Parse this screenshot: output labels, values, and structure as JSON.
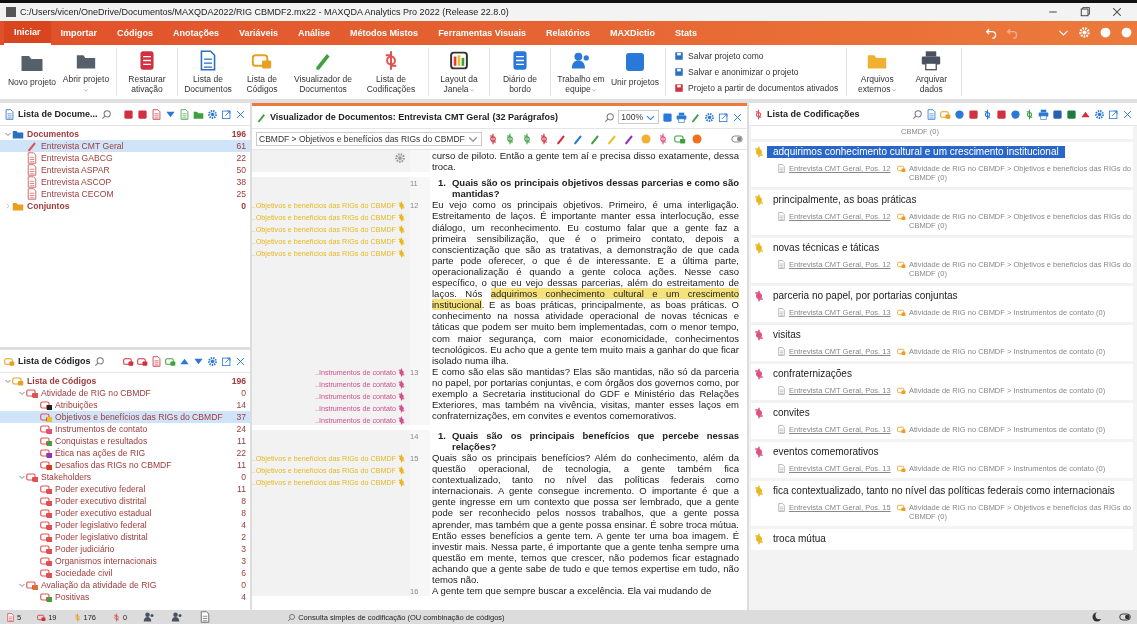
{
  "window": {
    "title": "C:/Users/vicen/OneDrive/Documentos/MAXQDA2022/RIG CBMDF2.mx22 - MAXQDA Analytics Pro 2022 (Release 22.8.0)"
  },
  "tabs": [
    {
      "label": "Iniciar",
      "selected": true
    },
    {
      "label": "Importar",
      "selected": false
    },
    {
      "label": "Códigos",
      "selected": false
    },
    {
      "label": "Anotações",
      "selected": false
    },
    {
      "label": "Variáveis",
      "selected": false
    },
    {
      "label": "Análise",
      "selected": false
    },
    {
      "label": "Métodos Mistos",
      "selected": false
    },
    {
      "label": "Ferramentas Visuais",
      "selected": false
    },
    {
      "label": "Relatórios",
      "selected": false
    },
    {
      "label": "MAXDictio",
      "selected": false
    },
    {
      "label": "Stats",
      "selected": false
    }
  ],
  "ribbon": {
    "groups": [
      [
        {
          "label": "Novo projeto",
          "dropdown": false
        },
        {
          "label": "Abrir projeto",
          "dropdown": true
        }
      ],
      [
        {
          "label": "Restaurar ativação",
          "dropdown": false
        }
      ],
      [
        {
          "label": "Lista de Documentos",
          "dropdown": false
        },
        {
          "label": "Lista de Códigos",
          "dropdown": false
        },
        {
          "label": "Visualizador de Documentos",
          "dropdown": false
        },
        {
          "label": "Lista de Codificações",
          "dropdown": false
        }
      ],
      [
        {
          "label": "Layout da Janela",
          "dropdown": true
        }
      ],
      [
        {
          "label": "Diário de bordo",
          "dropdown": false
        }
      ],
      [
        {
          "label": "Trabalho em equipe",
          "dropdown": true
        },
        {
          "label": "Unir projetos",
          "dropdown": false
        }
      ]
    ],
    "small_actions": [
      "Salvar projeto como",
      "Salvar e anonimizar o projeto",
      "Projeto a partir de documentos ativados"
    ],
    "end_buttons": [
      {
        "label": "Arquivos externos",
        "dropdown": true
      },
      {
        "label": "Arquivar dados",
        "dropdown": false
      }
    ]
  },
  "document_list": {
    "title": "Lista de Docume...",
    "items": [
      {
        "label": "Documentos",
        "count": "196",
        "kind": "folder",
        "selected": false,
        "expanded": true,
        "children": [
          {
            "label": "Entrevista CMT Geral",
            "count": "61",
            "kind": "open-doc",
            "selected": true
          },
          {
            "label": "Entrevista GABCG",
            "count": "22",
            "kind": "doc",
            "selected": false
          },
          {
            "label": "Entrevista ASPAR",
            "count": "50",
            "kind": "doc",
            "selected": false
          },
          {
            "label": "Entrevista ASCOP",
            "count": "38",
            "kind": "doc",
            "selected": false
          },
          {
            "label": "Entrevista CECOM",
            "count": "25",
            "kind": "doc",
            "selected": false
          }
        ]
      },
      {
        "label": "Conjuntos",
        "count": "0",
        "kind": "sets",
        "selected": false,
        "expanded": false
      }
    ]
  },
  "code_list": {
    "title": "Lista de Códigos",
    "items": [
      {
        "label": "Lista de Códigos",
        "count": "196",
        "kind": "root",
        "selected": false,
        "expanded": true,
        "children": [
          {
            "label": "Atividade de RIG no CBMDF",
            "count": "0",
            "color": "#e05050",
            "selected": false,
            "expanded": true,
            "children": [
              {
                "label": "Atribuições",
                "count": "14",
                "color": "#202020",
                "selected": false
              },
              {
                "label": "Objetivos e benefícios das RIGs do CBMDF",
                "count": "37",
                "color": "#e8c020",
                "selected": true
              },
              {
                "label": "Instrumentos de contato",
                "count": "24",
                "color": "#e05080",
                "selected": false
              },
              {
                "label": "Conquistas e resultados",
                "count": "11",
                "color": "#40a040",
                "selected": false
              },
              {
                "label": "Ética nas ações de RIG",
                "count": "22",
                "color": "#9030c0",
                "selected": false
              },
              {
                "label": "Desafios das RIGs no CBMDF",
                "count": "11",
                "color": "#d04020",
                "selected": false
              }
            ]
          },
          {
            "label": "Stakeholders",
            "count": "0",
            "color": "#e05050",
            "selected": false,
            "expanded": true,
            "children": [
              {
                "label": "Poder executivo federal",
                "count": "11",
                "color": "#e05050",
                "selected": false
              },
              {
                "label": "Poder executivo distrital",
                "count": "8",
                "color": "#e05050",
                "selected": false
              },
              {
                "label": "Poder executivo estadual",
                "count": "8",
                "color": "#e05050",
                "selected": false
              },
              {
                "label": "Poder legislativo federal",
                "count": "4",
                "color": "#e05050",
                "selected": false
              },
              {
                "label": "Poder legislativo distrital",
                "count": "2",
                "color": "#e05050",
                "selected": false
              },
              {
                "label": "Poder judiciário",
                "count": "3",
                "color": "#e05050",
                "selected": false
              },
              {
                "label": "Organismos internacionais",
                "count": "3",
                "color": "#e05050",
                "selected": false
              },
              {
                "label": "Sociedade civil",
                "count": "6",
                "color": "#e05050",
                "selected": false
              }
            ]
          },
          {
            "label": "Avaliação da atividade de RIG",
            "count": "0",
            "color": "#e07030",
            "selected": false,
            "expanded": true,
            "children": [
              {
                "label": "Positivas",
                "count": "4",
                "color": "#40a040",
                "selected": false
              }
            ]
          }
        ]
      }
    ]
  },
  "document_browser": {
    "title": "Visualizador de Documentos: Entrevista CMT Geral",
    "paragraph_count": "(32 Parágrafos)",
    "zoom": "100%",
    "code_selector": "CBMDF > Objetivos e benefícios das RIGs do CBMDF",
    "paragraphs": [
      {
        "kind": "body",
        "segments": [
          {
            "text": "curso de piloto. Então a gente tem aí e precisa disso exatamente, dessa troca.",
            "highlight": false
          }
        ]
      },
      {
        "kind": "heading",
        "number": "11",
        "marker": "1.",
        "segments": [
          {
            "text": "Quais são os principais objetivos dessas parcerias e como são mantidas?",
            "highlight": false
          }
        ]
      },
      {
        "kind": "body",
        "number": "12",
        "codes": [
          {
            "label": "..Objetivos e benefícios das RIGs do CBMDF",
            "color": "#e8b820"
          },
          {
            "label": "..Objetivos e benefícios das RIGs do CBMDF",
            "color": "#e8b820"
          },
          {
            "label": "..Objetivos e benefícios das RIGs do CBMDF",
            "color": "#e8b820"
          },
          {
            "label": "..Objetivos e benefícios das RIGs do CBMDF",
            "color": "#e8b820"
          },
          {
            "label": "..Objetivos e benefícios das RIGs do CBMDF",
            "color": "#e8b820"
          }
        ],
        "segments": [
          {
            "text": "Eu vejo como os principais objetivos. Primeiro, é uma interligação. Estreitamento de laços. É importante manter essa interlocução, esse diálogo, um reconhecimento. Eu costumo falar que a gente faz a primeira sensibilização, que é o primeiro contato, depois a conscientização que são as tratativas, a demonstração de que cada parte pode oferecer, o que é de interessante. E a última parte, operacionalização é quando a gente coloca ações. Nesse caso específico, o que eu vejo dessas parcerias, além do estreitamento de laços. Nós ",
            "highlight": false
          },
          {
            "text": "adquirimos conhecimento cultural e um crescimento institucional",
            "highlight": true
          },
          {
            "text": ". E as boas práticas, principalmente, as boas práticas. O conhecimento na nossa atividade operacional de novas técnicas e táticas que podem ser muito bem implementadas, com o menor tempo, com maior segurança, com maior economicidade, conhecimentos tecnológicos. Eu acho que a gente tem muito mais a ganhar do que ficar isolado numa ilha.",
            "highlight": false
          }
        ]
      },
      {
        "kind": "body",
        "number": "13",
        "codes": [
          {
            "label": "..Instrumentos de contato",
            "color": "#d0508a"
          },
          {
            "label": "..Instrumentos de contato",
            "color": "#d0508a"
          },
          {
            "label": "..Instrumentos de contato",
            "color": "#d0508a"
          },
          {
            "label": "..Instrumentos de contato",
            "color": "#d0508a"
          },
          {
            "label": "..Instrumentos de contato",
            "color": "#d0508a"
          }
        ],
        "segments": [
          {
            "text": "E como são elas são mantidas? Elas são mantidas, não só da parceria no papel, por portarias conjuntas, e com órgãos dos governos como, por exemplo a Secretaria institucional do GDF e Ministério das Relações Exteriores, mas também na vivência, visitas, manter esses laços em confraternizações, em convites e eventos comemorativos.",
            "highlight": false
          }
        ]
      },
      {
        "kind": "heading",
        "number": "14",
        "marker": "1.",
        "segments": [
          {
            "text": "Quais são os principais benefícios que percebe nessas relações?",
            "highlight": false
          }
        ]
      },
      {
        "kind": "body",
        "number": "15",
        "codes": [
          {
            "label": "..Objetivos e benefícios das RIGs do CBMDF",
            "color": "#e8b820"
          },
          {
            "label": "..Objetivos e benefícios das RIGs do CBMDF",
            "color": "#e8b820"
          },
          {
            "label": "..Objetivos e benefícios das RIGs do CBMDF",
            "color": "#e8b820"
          }
        ],
        "segments": [
          {
            "text": "Quais são os principais benefícios? Além do conhecimento, além da questão operacional, de tecnologia, a gente também fica contextualizado, tanto no nível das políticas federais como internacionais. A gente consegue incremento. O importante é que a gente ingresse em um contexto que possa ser lembrado, que a gente pode ser reconhecido pelos nossos trabalhos, que a gente possa aprender, mas também que a gente possa ensinar. É sobre troca mútua. Então esses benefícios a gente tem. A gente ter uma boa imagem. É investir mais. Nessa parte, é importante que a gente tenha sempre uma questão em mente, temos que crescer, não podemos ficar estagnado achando que a gente sabe de tudo e que temos expertise em tudo, não temos não.",
            "highlight": false
          }
        ]
      },
      {
        "kind": "body",
        "number": "16",
        "segments": [
          {
            "text": "A gente tem que sempre buscar a excelência. Ela vai mudando de",
            "highlight": false
          }
        ]
      }
    ]
  },
  "coded_segments": {
    "title": "Lista de Codificações",
    "top_fragment": "CBMDF (0)",
    "items": [
      {
        "text": "adquirimos conhecimento cultural e um crescimento institucional",
        "color": "#e8b820",
        "selected": true,
        "source": "Entrevista CMT Geral, Pos. 12",
        "code_path": "Atividade de RIG no CBMDF > Objetivos e benefícios das RIGs do CBMDF (0)"
      },
      {
        "text": "principalmente, as boas práticas",
        "color": "#e8b820",
        "selected": false,
        "source": "Entrevista CMT Geral, Pos. 12",
        "code_path": "Atividade de RIG no CBMDF > Objetivos e benefícios das RIGs do CBMDF (0)"
      },
      {
        "text": "novas técnicas e táticas",
        "color": "#e8b820",
        "selected": false,
        "source": "Entrevista CMT Geral, Pos. 12",
        "code_path": "Atividade de RIG no CBMDF > Objetivos e benefícios das RIGs do CBMDF (0)"
      },
      {
        "text": "parceria no papel, por portarias conjuntas",
        "color": "#e05080",
        "selected": false,
        "source": "Entrevista CMT Geral, Pos. 13",
        "code_path": "Atividade de RIG no CBMDF > Instrumentos de contato (0)"
      },
      {
        "text": "visitas",
        "color": "#e05080",
        "selected": false,
        "source": "Entrevista CMT Geral, Pos. 13",
        "code_path": "Atividade de RIG no CBMDF > Instrumentos de contato (0)"
      },
      {
        "text": "confraternizações",
        "color": "#e05080",
        "selected": false,
        "source": "Entrevista CMT Geral, Pos. 13",
        "code_path": "Atividade de RIG no CBMDF > Instrumentos de contato (0)"
      },
      {
        "text": "convites",
        "color": "#e05080",
        "selected": false,
        "source": "Entrevista CMT Geral, Pos. 13",
        "code_path": "Atividade de RIG no CBMDF > Instrumentos de contato (0)"
      },
      {
        "text": "eventos comemorativos",
        "color": "#e05080",
        "selected": false,
        "source": "Entrevista CMT Geral, Pos. 13",
        "code_path": "Atividade de RIG no CBMDF > Instrumentos de contato (0)"
      },
      {
        "text": "fica contextualizado, tanto no nível das políticas federais como internacionais",
        "color": "#e8b820",
        "selected": false,
        "source": "Entrevista CMT Geral, Pos. 15",
        "code_path": "Atividade de RIG no CBMDF > Objetivos e benefícios das RIGs do CBMDF (0)"
      },
      {
        "text": "troca mútua",
        "color": "#e8b820",
        "selected": false
      }
    ]
  },
  "status_bar": {
    "documents": "5",
    "codes": "19",
    "codings": "176",
    "memos": "0",
    "message": "Consulta simples de codificação (OU combinação de códigos)"
  }
}
